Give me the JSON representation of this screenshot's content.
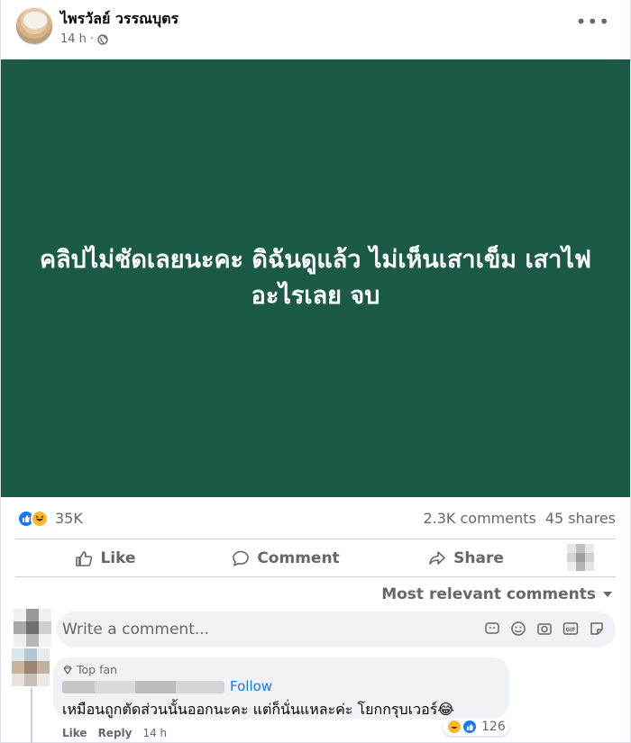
{
  "post": {
    "author": "ไพรวัลย์ วรรณบุตร",
    "time": "14 h",
    "privacy_icon": "globe-icon",
    "more_icon": "more-dots-icon",
    "image_text": "คลิปไม่ชัดเลยนะคะ ดิฉันดูแล้ว ไม่เห็นเสาเข็ม เสาไฟอะไรเลย จบ",
    "image_background": "#1b5a48"
  },
  "stats": {
    "reactions_count": "35K",
    "comments": "2.3K comments",
    "shares": "45 shares"
  },
  "actions": {
    "like": "Like",
    "comment": "Comment",
    "share": "Share"
  },
  "sort": {
    "label": "Most relevant comments"
  },
  "composer": {
    "placeholder": "Write a comment..."
  },
  "top_comment": {
    "badge": "Top fan",
    "follow": "Follow",
    "text": "เหมือนถูกตัดส่วนนั้นออกนะคะ แต่ก็นั่นแหละค่ะ โยกกรุบเวอร์😂",
    "reaction_count": "126",
    "like": "Like",
    "reply": "Reply",
    "time": "14 h"
  },
  "colors": {
    "accent": "#1877f2",
    "haha": "#f7b928",
    "muted": "#65676b"
  }
}
